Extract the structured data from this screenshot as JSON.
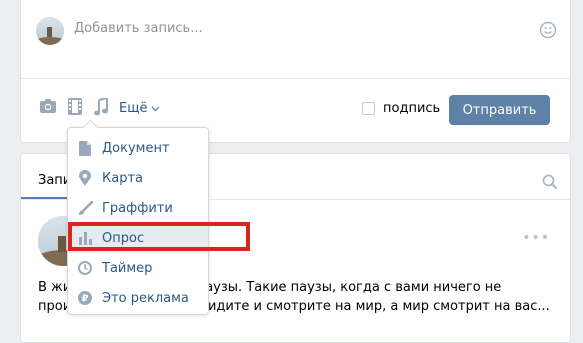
{
  "composer": {
    "placeholder": "Добавить запись...",
    "more_label": "Ещё",
    "signature_label": "подпись",
    "send_label": "Отправить"
  },
  "menu": {
    "items": [
      {
        "label": "Документ",
        "icon": "document-icon"
      },
      {
        "label": "Карта",
        "icon": "map-pin-icon"
      },
      {
        "label": "Граффити",
        "icon": "brush-icon"
      },
      {
        "label": "Опрос",
        "icon": "poll-icon",
        "highlighted": true
      },
      {
        "label": "Таймер",
        "icon": "clock-icon"
      },
      {
        "label": "Это реклама",
        "icon": "ruble-icon"
      }
    ]
  },
  "feed": {
    "tab_label": "Записи",
    "post_line_1": "В жизни должны быть паузы. Такие паузы, когда с вами ничего не",
    "post_line_2": "происходит, вы просто сидите и смотрите на мир, а мир смотрит на вас..."
  },
  "colors": {
    "accent": "#5181b8",
    "button": "#5e81a8",
    "link": "#2a5885",
    "highlight_box": "#d9261c",
    "icon": "#99a9bb"
  }
}
